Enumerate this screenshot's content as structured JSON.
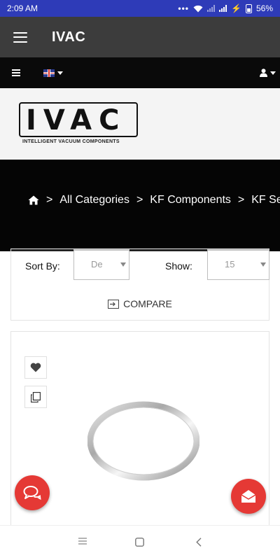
{
  "status_bar": {
    "time": "2:09 AM",
    "battery": "56%"
  },
  "app_bar": {
    "title": "IVAC"
  },
  "brand": {
    "logo_text": "IVAC",
    "tagline": "INTELLIGENT VACUUM COMPONENTS"
  },
  "breadcrumb": {
    "sep": ">",
    "items": [
      "All Categories",
      "KF Components",
      "KF Seals"
    ]
  },
  "toolbar": {
    "sort_label": "Sort By:",
    "sort_value": "De",
    "show_label": "Show:",
    "show_value": "15",
    "compare_label": "COMPARE"
  },
  "icons": {
    "menu": "hamburger-icon",
    "home": "home-icon",
    "user": "user-icon",
    "wishlist": "heart-icon",
    "compare": "copy-icon",
    "chat": "chat-icon",
    "mail": "envelope-icon"
  },
  "colors": {
    "status_bar": "#2e3bb8",
    "app_bar": "#3c3c3c",
    "nav_bar": "#0a0a0a",
    "hero": "#050505",
    "fab": "#e53935"
  }
}
